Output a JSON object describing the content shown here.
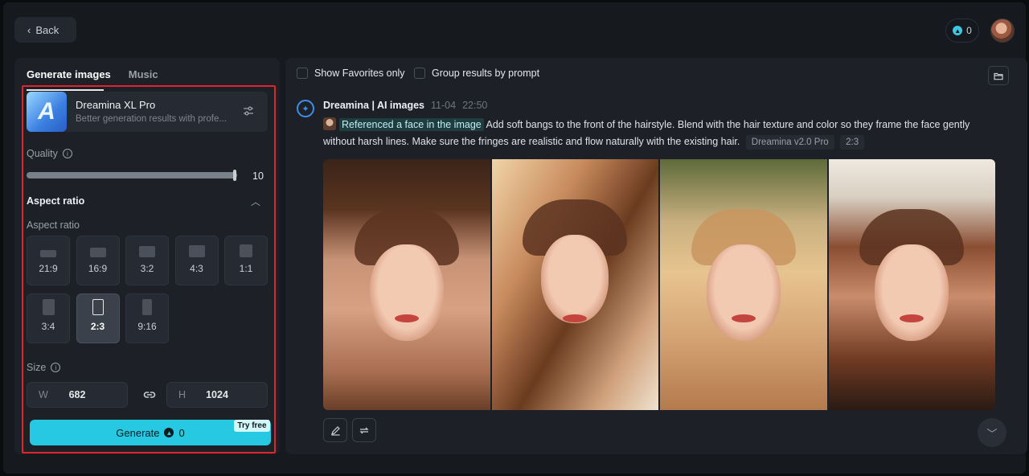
{
  "header": {
    "back_label": "Back",
    "credits": "0"
  },
  "left": {
    "tabs": [
      {
        "label": "Generate images",
        "active": true
      },
      {
        "label": "Music",
        "active": false
      }
    ],
    "model": {
      "thumb_letter": "A",
      "name": "Dreamina XL Pro",
      "description": "Better generation results with profe..."
    },
    "quality": {
      "label": "Quality",
      "value": "10",
      "fraction": 1.0
    },
    "aspect": {
      "header": "Aspect ratio",
      "sublabel": "Aspect ratio",
      "options": [
        {
          "label": "21:9",
          "selected": false
        },
        {
          "label": "16:9",
          "selected": false
        },
        {
          "label": "3:2",
          "selected": false
        },
        {
          "label": "4:3",
          "selected": false
        },
        {
          "label": "1:1",
          "selected": false
        },
        {
          "label": "3:4",
          "selected": false
        },
        {
          "label": "2:3",
          "selected": true
        },
        {
          "label": "9:16",
          "selected": false
        }
      ]
    },
    "size": {
      "label": "Size",
      "width_prefix": "W",
      "width": "682",
      "height_prefix": "H",
      "height": "1024"
    },
    "generate": {
      "label": "Generate",
      "cost": "0",
      "badge": "Try free",
      "color": "#26c9e1"
    }
  },
  "right": {
    "filters": {
      "favorites": "Show Favorites only",
      "group": "Group results by prompt"
    },
    "message": {
      "author": "Dreamina | AI images",
      "date": "11-04",
      "time": "22:50",
      "ref_tag": "Referenced a face in the image",
      "prompt": "Add soft bangs to the front of the hairstyle. Blend with the hair texture and color so they frame the face gently without harsh lines. Make sure the fringes are realistic and flow naturally with the existing hair.",
      "model_tag": "Dreamina v2.0 Pro",
      "ratio_tag": "2:3"
    }
  },
  "icons": {
    "back": "chevron-left-icon",
    "coin": "coin-icon",
    "settings": "sliders-icon",
    "info": "info-icon",
    "chevron": "chevron-up-icon",
    "link": "link-icon",
    "folder": "folder-icon",
    "edit": "pencil-icon",
    "regenerate": "repeat-icon",
    "scroll": "chevron-down-icon"
  }
}
